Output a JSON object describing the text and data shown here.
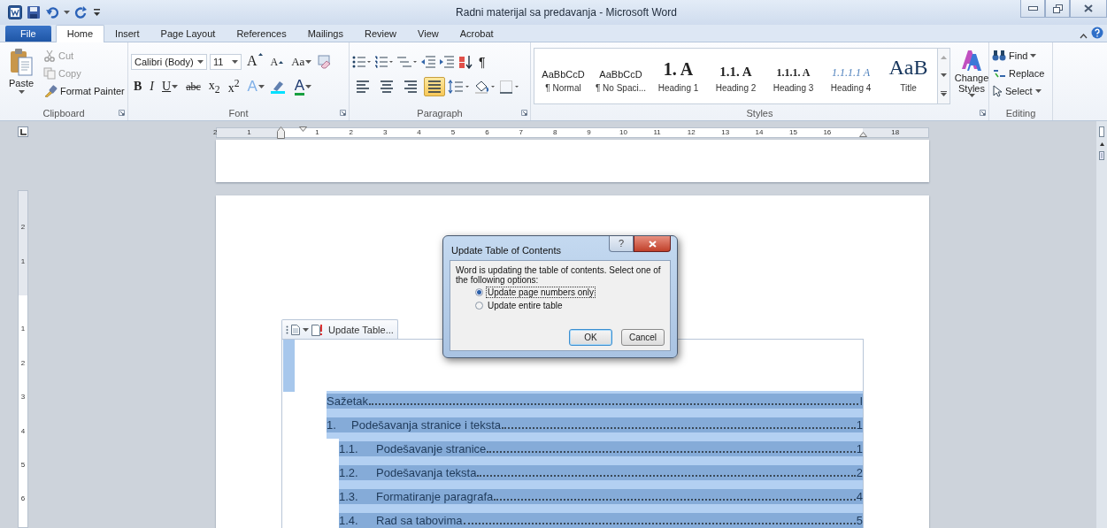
{
  "window": {
    "title": "Radni materijal sa predavanja - Microsoft Word"
  },
  "tabs": [
    {
      "label": "File",
      "kind": "file",
      "selected": false
    },
    {
      "label": "Home",
      "kind": "tab",
      "selected": true
    },
    {
      "label": "Insert",
      "kind": "tab",
      "selected": false
    },
    {
      "label": "Page Layout",
      "kind": "tab",
      "selected": false
    },
    {
      "label": "References",
      "kind": "tab",
      "selected": false
    },
    {
      "label": "Mailings",
      "kind": "tab",
      "selected": false
    },
    {
      "label": "Review",
      "kind": "tab",
      "selected": false
    },
    {
      "label": "View",
      "kind": "tab",
      "selected": false
    },
    {
      "label": "Acrobat",
      "kind": "tab",
      "selected": false
    }
  ],
  "clipboard": {
    "label": "Clipboard",
    "paste": "Paste",
    "cut": "Cut",
    "copy": "Copy",
    "format_painter": "Format Painter"
  },
  "font": {
    "label": "Font",
    "name": "Calibri (Body)",
    "size": "11",
    "row1_buttons": [
      {
        "label": "A",
        "kind": "grow"
      },
      {
        "label": "A",
        "kind": "shrink"
      },
      {
        "label": "Aa",
        "kind": "case"
      }
    ],
    "row2_buttons": [
      {
        "label": "B",
        "kind": "bold"
      },
      {
        "label": "I",
        "kind": "italic"
      },
      {
        "label": "U",
        "kind": "underline"
      },
      {
        "label": "abc",
        "kind": "strike"
      },
      {
        "label": "x$_{2}$",
        "kind": "plain"
      },
      {
        "label": "x$^{2}$",
        "kind": "plain"
      },
      {
        "label": "A",
        "kind": "effect"
      },
      {
        "label": "A",
        "kind": "color"
      }
    ]
  },
  "paragraph": {
    "label": "Paragraph",
    "pilcrow": "¶",
    "alignment": [
      {
        "kind": "left",
        "selected": false
      },
      {
        "kind": "center",
        "selected": false
      },
      {
        "kind": "right",
        "selected": false
      },
      {
        "kind": "justify",
        "selected": true
      }
    ]
  },
  "styles": {
    "label": "Styles",
    "change_styles": "Change Styles",
    "items": [
      {
        "preview": "AaBbCcD",
        "name": "¶ Normal",
        "kind": "normal"
      },
      {
        "preview": "AaBbCcD",
        "name": "¶ No Spaci...",
        "kind": "normal"
      },
      {
        "preview": "1. A",
        "name": "Heading 1",
        "kind": "h1"
      },
      {
        "preview": "1.1. A",
        "name": "Heading 2",
        "kind": "h2"
      },
      {
        "preview": "1.1.1. A",
        "name": "Heading 3",
        "kind": "h3"
      },
      {
        "preview": "1.1.1.1 A",
        "name": "Heading 4",
        "kind": "h4"
      },
      {
        "preview": "AaB",
        "name": "Title",
        "kind": "title"
      }
    ]
  },
  "editing": {
    "label": "Editing",
    "find": "Find",
    "replace": "Replace",
    "select": "Select"
  },
  "ruler": {
    "numbers": [
      "2",
      "1",
      "1",
      "2",
      "3",
      "4",
      "5",
      "6",
      "7",
      "8",
      "9",
      "10",
      "11",
      "12",
      "13",
      "14",
      "15",
      "16",
      "18"
    ]
  },
  "vertical_ruler": {
    "numbers": [
      "2",
      "1",
      "1",
      "2",
      "3",
      "4",
      "5",
      "6"
    ]
  },
  "toc": {
    "tab_label": "Update Table...",
    "entries": [
      {
        "title": "Sažetak",
        "page": "I",
        "selected": true
      },
      {
        "number": "1.",
        "title": "Podešavanja stranice i teksta",
        "page": "1",
        "selected": true,
        "children": [
          {
            "number": "1.1.",
            "title": "Podešavanje stranice",
            "page": "1",
            "selected": true
          },
          {
            "number": "1.2.",
            "title": "Podešavanja teksta",
            "page": "2",
            "selected": true
          },
          {
            "number": "1.3.",
            "title": "Formatiranje paragrafa",
            "page": "4",
            "selected": true
          },
          {
            "number": "1.4.",
            "title": "Rad sa tabovima",
            "page": "5",
            "selected": true
          }
        ]
      }
    ]
  },
  "dialog": {
    "title": "Update Table of Contents",
    "help": "?",
    "message": "Word is updating the table of contents.  Select one of the following options:",
    "options": [
      {
        "label": "Update page numbers only",
        "selected": true
      },
      {
        "label": "Update entire table",
        "selected": false
      }
    ],
    "buttons": [
      {
        "label": "OK",
        "default": true
      },
      {
        "label": "Cancel",
        "default": false
      }
    ]
  }
}
